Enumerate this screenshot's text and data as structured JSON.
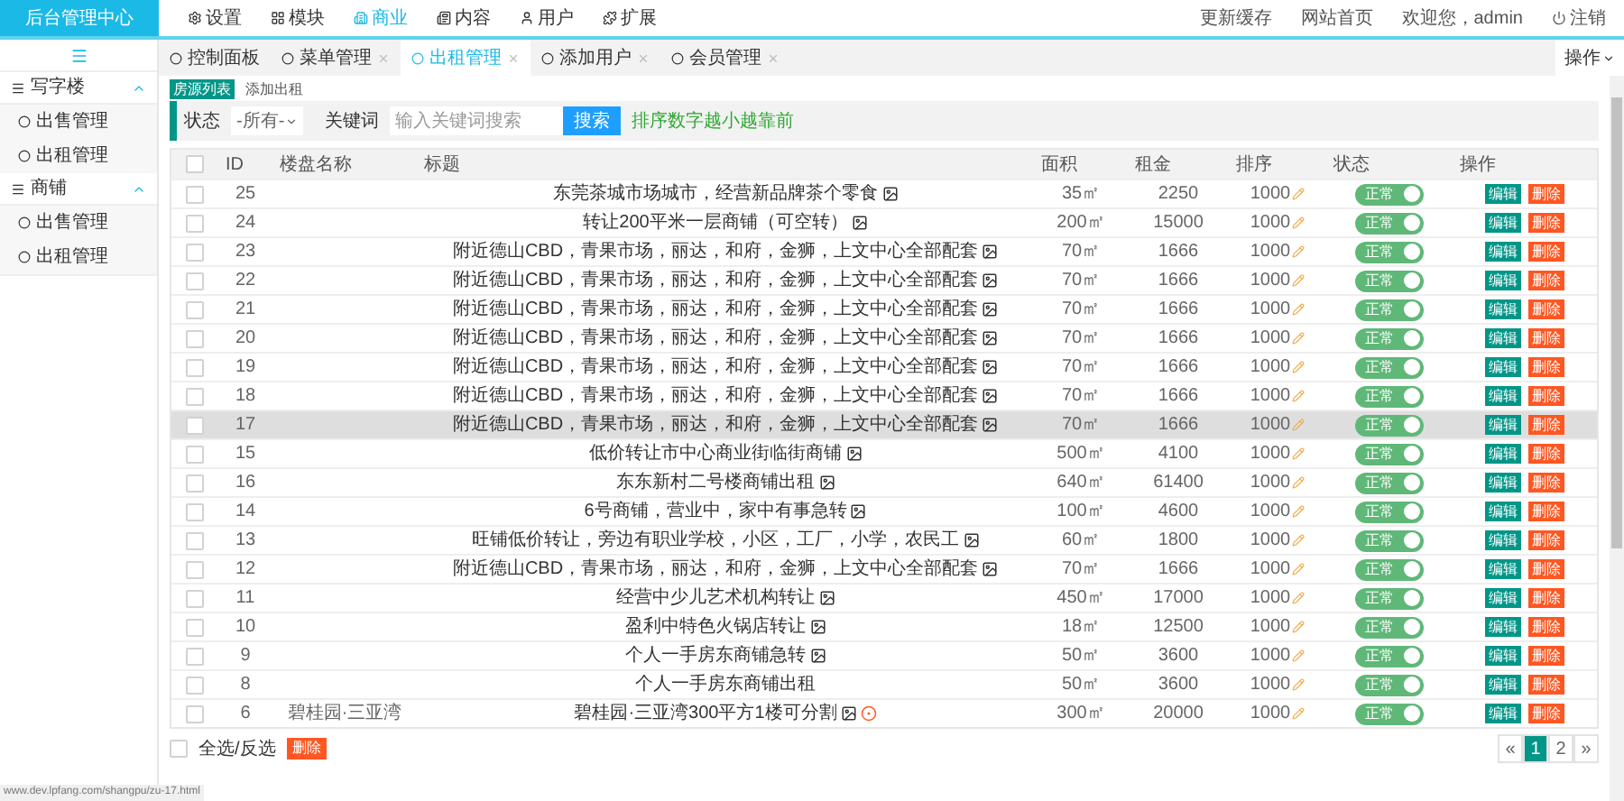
{
  "header": {
    "logo": "后台管理中心",
    "nav": [
      {
        "label": "设置",
        "selected": false
      },
      {
        "label": "模块",
        "selected": false
      },
      {
        "label": "商业",
        "selected": true
      },
      {
        "label": "内容",
        "selected": false
      },
      {
        "label": "用户",
        "selected": false
      },
      {
        "label": "扩展",
        "selected": false
      }
    ],
    "links": [
      "更新缓存",
      "网站首页",
      "欢迎您，admin"
    ],
    "logout": "注销"
  },
  "sidebar": {
    "groups": [
      {
        "label": "写字楼",
        "expanded": true,
        "items": [
          "出售管理",
          "出租管理"
        ]
      },
      {
        "label": "商铺",
        "expanded": true,
        "items": [
          "出售管理",
          "出租管理"
        ]
      }
    ]
  },
  "tabs": [
    {
      "label": "控制面板",
      "closable": false,
      "selected": false
    },
    {
      "label": "菜单管理",
      "closable": true,
      "selected": false
    },
    {
      "label": "出租管理",
      "closable": true,
      "selected": true
    },
    {
      "label": "添加用户",
      "closable": true,
      "selected": false
    },
    {
      "label": "会员管理",
      "closable": true,
      "selected": false
    }
  ],
  "actions_menu": "操作",
  "subtabs": [
    {
      "label": "房源列表",
      "selected": true
    },
    {
      "label": "添加出租",
      "selected": false
    }
  ],
  "filter": {
    "status_label": "状态",
    "status_value": "-所有-",
    "keyword_label": "关键词",
    "keyword_placeholder": "输入关键词搜索",
    "search_button": "搜索",
    "hint": "排序数字越小越靠前"
  },
  "table": {
    "header_checked": false,
    "columns": [
      "ID",
      "楼盘名称",
      "标题",
      "面积",
      "租金",
      "排序",
      "状态",
      "操作"
    ],
    "rows": [
      {
        "id": "25",
        "building": "",
        "title": "东莞茶城市场城市，经营新品牌茶个零食",
        "image": true,
        "recommended": false,
        "area": "35㎡",
        "rent": "2250",
        "sort": "1000",
        "on": true,
        "status": "正常",
        "edit": "编辑",
        "delete": "删除",
        "checked": false,
        "highlighted": false
      },
      {
        "id": "24",
        "building": "",
        "title": "转让200平米一层商铺（可空转）",
        "image": true,
        "recommended": false,
        "area": "200㎡",
        "rent": "15000",
        "sort": "1000",
        "on": true,
        "status": "正常",
        "edit": "编辑",
        "delete": "删除",
        "checked": false,
        "highlighted": false
      },
      {
        "id": "23",
        "building": "",
        "title": "附近德山CBD，青果市场，丽达，和府，金狮，上文中心全部配套",
        "image": true,
        "recommended": false,
        "area": "70㎡",
        "rent": "1666",
        "sort": "1000",
        "on": true,
        "status": "正常",
        "edit": "编辑",
        "delete": "删除",
        "checked": false,
        "highlighted": false
      },
      {
        "id": "22",
        "building": "",
        "title": "附近德山CBD，青果市场，丽达，和府，金狮，上文中心全部配套",
        "image": true,
        "recommended": false,
        "area": "70㎡",
        "rent": "1666",
        "sort": "1000",
        "on": true,
        "status": "正常",
        "edit": "编辑",
        "delete": "删除",
        "checked": false,
        "highlighted": false
      },
      {
        "id": "21",
        "building": "",
        "title": "附近德山CBD，青果市场，丽达，和府，金狮，上文中心全部配套",
        "image": true,
        "recommended": false,
        "area": "70㎡",
        "rent": "1666",
        "sort": "1000",
        "on": true,
        "status": "正常",
        "edit": "编辑",
        "delete": "删除",
        "checked": false,
        "highlighted": false
      },
      {
        "id": "20",
        "building": "",
        "title": "附近德山CBD，青果市场，丽达，和府，金狮，上文中心全部配套",
        "image": true,
        "recommended": false,
        "area": "70㎡",
        "rent": "1666",
        "sort": "1000",
        "on": true,
        "status": "正常",
        "edit": "编辑",
        "delete": "删除",
        "checked": false,
        "highlighted": false
      },
      {
        "id": "19",
        "building": "",
        "title": "附近德山CBD，青果市场，丽达，和府，金狮，上文中心全部配套",
        "image": true,
        "recommended": false,
        "area": "70㎡",
        "rent": "1666",
        "sort": "1000",
        "on": true,
        "status": "正常",
        "edit": "编辑",
        "delete": "删除",
        "checked": false,
        "highlighted": false
      },
      {
        "id": "18",
        "building": "",
        "title": "附近德山CBD，青果市场，丽达，和府，金狮，上文中心全部配套",
        "image": true,
        "recommended": false,
        "area": "70㎡",
        "rent": "1666",
        "sort": "1000",
        "on": true,
        "status": "正常",
        "edit": "编辑",
        "delete": "删除",
        "checked": false,
        "highlighted": false
      },
      {
        "id": "17",
        "building": "",
        "title": "附近德山CBD，青果市场，丽达，和府，金狮，上文中心全部配套",
        "image": true,
        "recommended": false,
        "area": "70㎡",
        "rent": "1666",
        "sort": "1000",
        "on": true,
        "status": "正常",
        "edit": "编辑",
        "delete": "删除",
        "checked": false,
        "highlighted": true
      },
      {
        "id": "15",
        "building": "",
        "title": "低价转让市中心商业街临街商铺",
        "image": true,
        "recommended": false,
        "area": "500㎡",
        "rent": "4100",
        "sort": "1000",
        "on": true,
        "status": "正常",
        "edit": "编辑",
        "delete": "删除",
        "checked": false,
        "highlighted": false
      },
      {
        "id": "16",
        "building": "",
        "title": "东东新村二号楼商铺出租",
        "image": true,
        "recommended": false,
        "area": "640㎡",
        "rent": "61400",
        "sort": "1000",
        "on": true,
        "status": "正常",
        "edit": "编辑",
        "delete": "删除",
        "checked": false,
        "highlighted": false
      },
      {
        "id": "14",
        "building": "",
        "title": "6号商铺，营业中，家中有事急转",
        "image": true,
        "recommended": false,
        "area": "100㎡",
        "rent": "4600",
        "sort": "1000",
        "on": true,
        "status": "正常",
        "edit": "编辑",
        "delete": "删除",
        "checked": false,
        "highlighted": false
      },
      {
        "id": "13",
        "building": "",
        "title": "旺铺低价转让，旁边有职业学校，小区，工厂，小学，农民工",
        "image": true,
        "recommended": false,
        "area": "60㎡",
        "rent": "1800",
        "sort": "1000",
        "on": true,
        "status": "正常",
        "edit": "编辑",
        "delete": "删除",
        "checked": false,
        "highlighted": false
      },
      {
        "id": "12",
        "building": "",
        "title": "附近德山CBD，青果市场，丽达，和府，金狮，上文中心全部配套",
        "image": true,
        "recommended": false,
        "area": "70㎡",
        "rent": "1666",
        "sort": "1000",
        "on": true,
        "status": "正常",
        "edit": "编辑",
        "delete": "删除",
        "checked": false,
        "highlighted": false
      },
      {
        "id": "11",
        "building": "",
        "title": "经营中少儿艺术机构转让",
        "image": true,
        "recommended": false,
        "area": "450㎡",
        "rent": "17000",
        "sort": "1000",
        "on": true,
        "status": "正常",
        "edit": "编辑",
        "delete": "删除",
        "checked": false,
        "highlighted": false
      },
      {
        "id": "10",
        "building": "",
        "title": "盈利中特色火锅店转让",
        "image": true,
        "recommended": false,
        "area": "18㎡",
        "rent": "12500",
        "sort": "1000",
        "on": true,
        "status": "正常",
        "edit": "编辑",
        "delete": "删除",
        "checked": false,
        "highlighted": false
      },
      {
        "id": "9",
        "building": "",
        "title": "个人一手房东商铺急转",
        "image": true,
        "recommended": false,
        "area": "50㎡",
        "rent": "3600",
        "sort": "1000",
        "on": true,
        "status": "正常",
        "edit": "编辑",
        "delete": "删除",
        "checked": false,
        "highlighted": false
      },
      {
        "id": "8",
        "building": "",
        "title": "个人一手房东商铺出租",
        "image": false,
        "recommended": false,
        "area": "50㎡",
        "rent": "3600",
        "sort": "1000",
        "on": true,
        "status": "正常",
        "edit": "编辑",
        "delete": "删除",
        "checked": false,
        "highlighted": false
      },
      {
        "id": "6",
        "building": "碧桂园·三亚湾",
        "title": "碧桂园·三亚湾300平方1楼可分割",
        "image": true,
        "recommended": true,
        "area": "300㎡",
        "rent": "20000",
        "sort": "1000",
        "on": true,
        "status": "正常",
        "edit": "编辑",
        "delete": "删除",
        "checked": false,
        "highlighted": false
      }
    ]
  },
  "footer": {
    "select_all": "全选/反选",
    "select_all_checked": false,
    "delete": "删除",
    "pages": [
      {
        "label": "«",
        "selected": false
      },
      {
        "label": "1",
        "selected": true
      },
      {
        "label": "2",
        "selected": false
      },
      {
        "label": "»",
        "selected": false
      }
    ]
  },
  "status_bar": "www.dev.lpfang.com/shangpu/zu-17.html"
}
